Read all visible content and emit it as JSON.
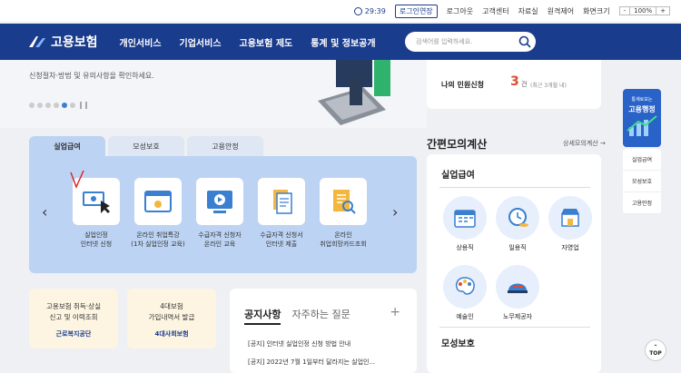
{
  "topbar": {
    "timer": "29:39",
    "extend_login": "로그인연장",
    "logout": "로그아웃",
    "customer_center": "고객센터",
    "library": "자료실",
    "remote": "원격제어",
    "screen_size": "화면크기",
    "zoom_minus": "-",
    "zoom_level": "100%",
    "zoom_plus": "+"
  },
  "nav": {
    "logo_text": "고용보험",
    "menu": [
      "개인서비스",
      "기업서비스",
      "고용보험 제도",
      "통계 및 정보공개"
    ],
    "search_placeholder": "검색어를 입력하세요."
  },
  "hero": {
    "subtitle": "신청절차·방법 및 유의사항을 확인하세요."
  },
  "complaint": {
    "label": "나의 민원신청",
    "count": "3",
    "unit": "건",
    "hint": "(최근 3개월 내)"
  },
  "tabs": [
    "실업급여",
    "모성보호",
    "고용안정"
  ],
  "services": [
    {
      "line1": "실업인정",
      "line2": "인터넷 신청"
    },
    {
      "line1": "온라인 취업특강",
      "line2": "(1차 실업인정 교육)"
    },
    {
      "line1": "수급자격 신청자",
      "line2": "온라인 교육"
    },
    {
      "line1": "수급자격 신청서",
      "line2": "인터넷 제출"
    },
    {
      "line1": "온라인",
      "line2": "취업희망카드조회"
    }
  ],
  "cards": [
    {
      "line1": "고용보험 취득·상실",
      "line2": "신고 및 이력조회",
      "org": "근로복지공단"
    },
    {
      "line1": "4대보험",
      "line2": "가입내역서 발급",
      "org": "4대사회보험"
    }
  ],
  "notice": {
    "tab_on": "공지사항",
    "tab_off": "자주하는 질문",
    "plus": "+",
    "items": [
      "[공지] 인터넷 실업인정 신청 방법 안내",
      "[공지] 2022년 7월 1일부터 달라지는 실업인..."
    ]
  },
  "calc": {
    "title": "간편모의계산",
    "more": "상세모의계산",
    "section1": "실업급여",
    "jobs": [
      "상용직",
      "일용직",
      "자영업",
      "예술인",
      "노무제공자"
    ],
    "section2": "모성보호"
  },
  "side": {
    "banner_small": "통계로보는",
    "banner_big": "고용행정",
    "quick": [
      "실업급여",
      "모성보호",
      "고용안정"
    ]
  },
  "top_button": "TOP",
  "colors": {
    "brand": "#1a3c8c",
    "panel": "#bcd3f3",
    "accent_red": "#e04a2f"
  }
}
